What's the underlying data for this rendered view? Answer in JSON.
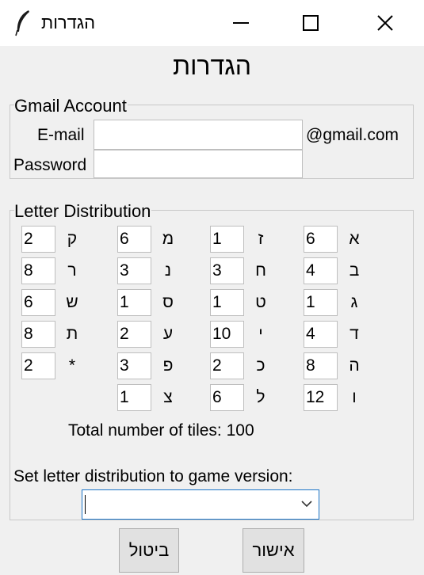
{
  "window": {
    "title": "הגדרות"
  },
  "dialog": {
    "title": "הגדרות"
  },
  "gmail": {
    "legend": "Gmail Account",
    "email_label": "E-mail",
    "email_value": "",
    "email_suffix": "@gmail.com",
    "password_label": "Password",
    "password_value": ""
  },
  "distribution": {
    "legend": "Letter Distribution",
    "columns": [
      [
        {
          "letter": "א",
          "count": "6"
        },
        {
          "letter": "ב",
          "count": "4"
        },
        {
          "letter": "ג",
          "count": "1"
        },
        {
          "letter": "ד",
          "count": "4"
        },
        {
          "letter": "ה",
          "count": "8"
        },
        {
          "letter": "ו",
          "count": "12"
        }
      ],
      [
        {
          "letter": "ז",
          "count": "1"
        },
        {
          "letter": "ח",
          "count": "3"
        },
        {
          "letter": "ט",
          "count": "1"
        },
        {
          "letter": "י",
          "count": "10"
        },
        {
          "letter": "כ",
          "count": "2"
        },
        {
          "letter": "ל",
          "count": "6"
        }
      ],
      [
        {
          "letter": "מ",
          "count": "6"
        },
        {
          "letter": "נ",
          "count": "3"
        },
        {
          "letter": "ס",
          "count": "1"
        },
        {
          "letter": "ע",
          "count": "2"
        },
        {
          "letter": "פ",
          "count": "3"
        },
        {
          "letter": "צ",
          "count": "1"
        }
      ],
      [
        {
          "letter": "ק",
          "count": "2"
        },
        {
          "letter": "ר",
          "count": "8"
        },
        {
          "letter": "ש",
          "count": "6"
        },
        {
          "letter": "ת",
          "count": "8"
        },
        {
          "letter": "*",
          "count": "2"
        }
      ]
    ],
    "total_label": "Total number of tiles: 100",
    "version_label": "Set letter distribution to game version:",
    "version_value": ""
  },
  "buttons": {
    "cancel": "ביטול",
    "ok": "אישור"
  }
}
